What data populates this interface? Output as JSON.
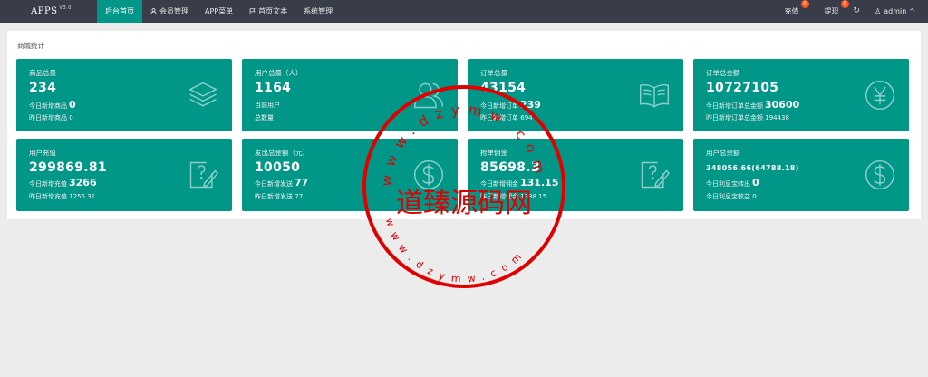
{
  "header": {
    "logo": "APPS",
    "version": "V3.0",
    "nav": [
      {
        "label": "后台首页",
        "icon": "",
        "active": true
      },
      {
        "label": "会员管理",
        "icon": "user-icon"
      },
      {
        "label": "APP菜单",
        "icon": ""
      },
      {
        "label": "首页文本",
        "icon": "flag-icon"
      },
      {
        "label": "系统管理",
        "icon": ""
      }
    ],
    "charge_label": "充值",
    "charge_badge": "0",
    "withdraw_label": "提现",
    "withdraw_badge": "0",
    "refresh_icon": "↻",
    "user_icon": "♙",
    "username": "admin",
    "user_caret": "^"
  },
  "panel": {
    "title": "商城统计"
  },
  "cards": [
    {
      "title": "商品总量",
      "value": "234",
      "line1_label": "今日新增商品",
      "line1_value": "0",
      "line2_label": "昨日新增商品",
      "line2_value": "0",
      "icon": "layers-icon"
    },
    {
      "title": "用户总量（人）",
      "value": "1164",
      "line1_label": "当前用户",
      "line1_value": "",
      "line2_label": "总数量",
      "line2_value": "",
      "icon": "users-icon"
    },
    {
      "title": "订单总量",
      "value": "43154",
      "line1_label": "今日新增订单",
      "line1_value": "239",
      "line2_label": "昨日新增订单",
      "line2_value": "694",
      "icon": "book-icon"
    },
    {
      "title": "订单总金额",
      "value": "10727105",
      "line1_label": "今日新增订单总金额",
      "line1_value": "30600",
      "line2_label": "昨日新增订单总金额",
      "line2_value": "194438",
      "icon": "yen-icon"
    },
    {
      "title": "用户充值",
      "value": "299869.81",
      "line1_label": "今日新增充值",
      "line1_value": "3266",
      "line2_label": "昨日新增充值",
      "line2_value": "1255.31",
      "icon": "edit-icon"
    },
    {
      "title": "发出总金额（元）",
      "value": "10050",
      "line1_label": "今日新增发送",
      "line1_value": "77",
      "line2_label": "昨日新增发送",
      "line2_value": "77",
      "icon": "dollar-icon"
    },
    {
      "title": "抢单佣金",
      "value": "85698.3",
      "line1_label": "今日新增佣金",
      "line1_value": "131.15",
      "line2_label": "昨日新增佣金",
      "line2_value": "1388.15",
      "icon": "edit-icon"
    },
    {
      "title": "用户总余额",
      "value": "348056.66(64788.18)",
      "line1_label": "今日利息宝转出",
      "line1_value": "0",
      "line2_label": "今日利息宝收益",
      "line2_value": "0",
      "icon": "dollar-icon"
    }
  ],
  "watermark": {
    "text": "道臻源码网",
    "url_top": "www.dzymw.com",
    "url_bottom": "www.dzymw.com",
    "color": "#e00000"
  },
  "colors": {
    "card": "#009688",
    "topbar": "#393d49",
    "badge": "#ff5722"
  }
}
